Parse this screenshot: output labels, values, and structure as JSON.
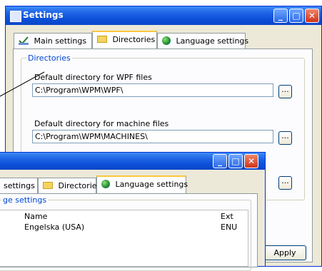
{
  "settings_window": {
    "title": "Settings",
    "tabs": [
      {
        "label": "Main settings"
      },
      {
        "label": "Directories"
      },
      {
        "label": "Language settings"
      }
    ],
    "group_title": "Directories",
    "wpf_label": "Default directory for WPF files",
    "wpf_value": "C:\\Program\\WPM\\WPF\\",
    "machine_label": "Default directory for machine files",
    "machine_value": "C:\\Program\\WPM\\MACHINES\\",
    "browse_label": "...",
    "apply_label": "Apply"
  },
  "language_window": {
    "tabs": [
      {
        "label": "settings"
      },
      {
        "label": "Directories"
      },
      {
        "label": "Language settings"
      }
    ],
    "group_title": "ge settings",
    "columns": {
      "name": "Name",
      "ext": "Ext"
    },
    "rows": [
      {
        "name": "Engelska (USA)",
        "ext": "ENU"
      }
    ]
  },
  "colors": {
    "title_blue": "#0a46c8",
    "tab_highlight": "#ffc83c",
    "group_label": "#0046d5"
  }
}
